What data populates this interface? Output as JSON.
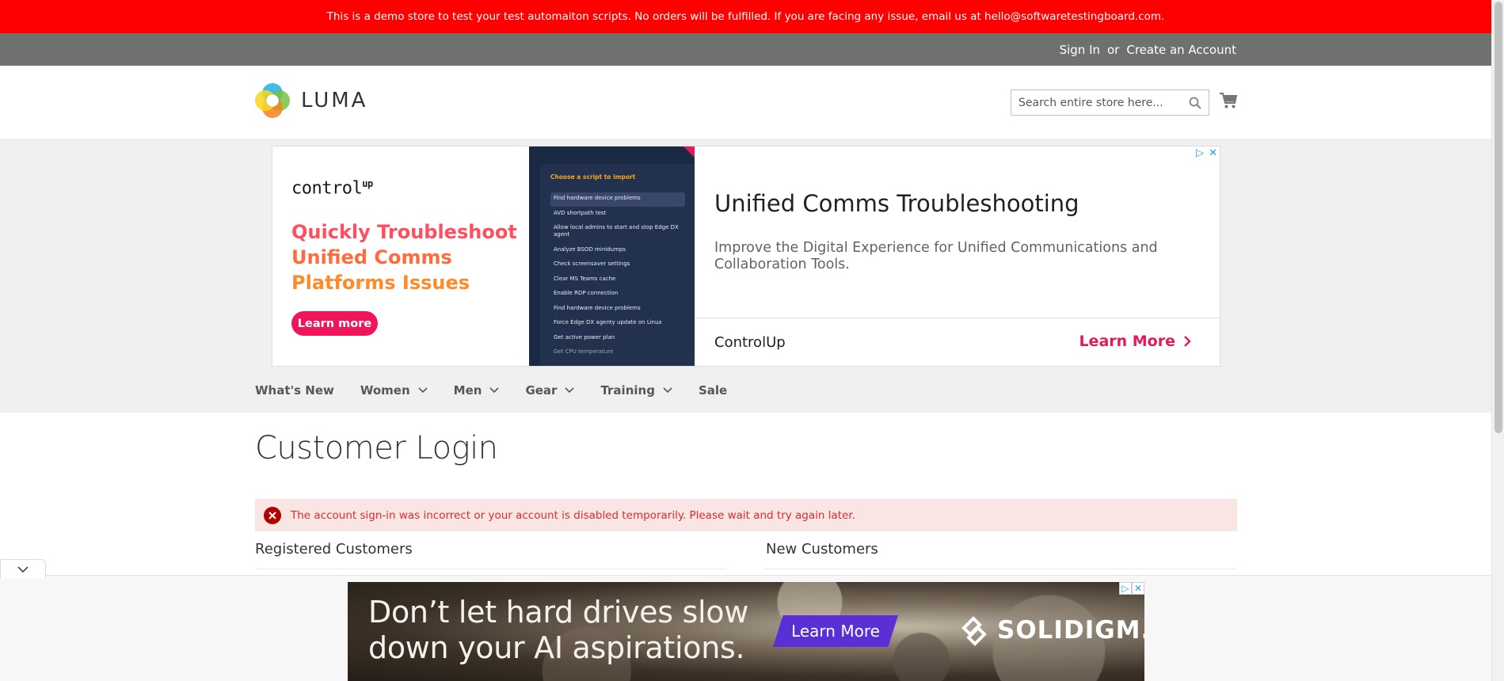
{
  "demo_notice": "This is a demo store to test your test automaiton scripts. No orders will be fulfilled. If you are facing any issue, email us at hello@softwaretestingboard.com.",
  "top_links": {
    "sign_in": "Sign In",
    "or": "or",
    "create_account": "Create an Account"
  },
  "header": {
    "logo_text": "LUMA",
    "search_placeholder": "Search entire store here...",
    "icons": [
      "search-icon",
      "cart-icon"
    ]
  },
  "ad": {
    "brand_logo": "control",
    "brand_logo_sup": "up",
    "headline": [
      "Quickly Troubleshoot",
      "Unified Comms",
      "Platforms Issues"
    ],
    "cta": "Learn more",
    "screen_title": "Choose a script to import",
    "scripts": [
      "Find hardware device problems",
      "AVD shortpath test",
      "Allow local admins to start and stop Edge DX agent",
      "Analyze BSOD minidumps",
      "Check screensaver settings",
      "Clear MS Teams cache",
      "Enable RDP connection",
      "Find hardware device problems",
      "Force Edge DX agenty update on Linux",
      "Get active power plan",
      "Get CPU temperature"
    ],
    "title": "Unified Comms Troubleshooting",
    "description": "Improve the Digital Experience for Unified Communications and Collaboration Tools.",
    "advertiser": "ControlUp",
    "learn_more": "Learn More",
    "choice_icons": [
      "adchoices-icon",
      "close-icon"
    ]
  },
  "nav": {
    "items": [
      {
        "label": "What's New",
        "has_dropdown": false
      },
      {
        "label": "Women",
        "has_dropdown": true
      },
      {
        "label": "Men",
        "has_dropdown": true
      },
      {
        "label": "Gear",
        "has_dropdown": true
      },
      {
        "label": "Training",
        "has_dropdown": true
      },
      {
        "label": "Sale",
        "has_dropdown": false
      }
    ]
  },
  "main": {
    "page_title": "Customer Login",
    "error_message": "The account sign-in was incorrect or your account is disabled temporarily. Please wait and try again later.",
    "registered_heading": "Registered Customers",
    "new_heading": "New Customers"
  },
  "bottom_ad": {
    "headline_1": "Don’t let hard drives slow",
    "headline_2": "down your AI aspirations.",
    "cta": "Learn More",
    "brand": "SOLIDIGM."
  },
  "colors": {
    "demo_bar": "#ff0000",
    "top_links_bar": "#6e716e",
    "error_bg": "#fae5e5",
    "error_text": "#e02b27",
    "ad_accent": "#e6195a"
  }
}
